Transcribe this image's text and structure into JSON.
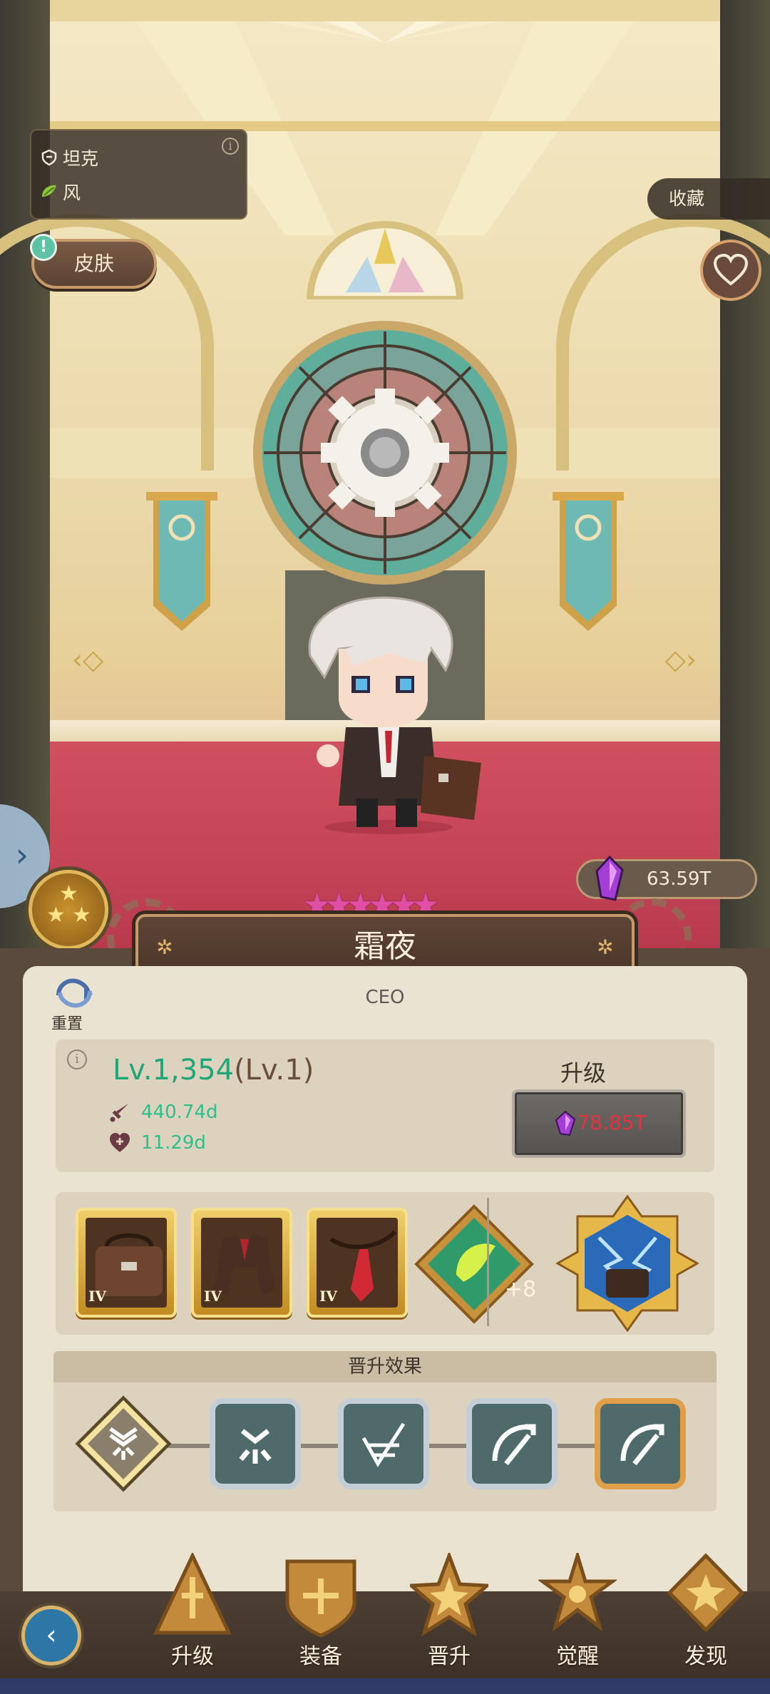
{
  "hero": {
    "role": "坦克",
    "element": "风",
    "name": "霜夜",
    "title": "CEO",
    "rarity_stars": 6,
    "tier_stars": 3
  },
  "buttons": {
    "skin": "皮肤",
    "collect": "收藏",
    "reset": "重置"
  },
  "currency": {
    "gems": "63.59T"
  },
  "stats": {
    "level": "Lv.1,354",
    "level_sub": "(Lv.1)",
    "attack": "440.74d",
    "hp": "11.29d",
    "upgrade_label": "升级",
    "upgrade_cost": "78.85T"
  },
  "equipment": {
    "items": [
      {
        "name": "briefcase",
        "tier": "IV"
      },
      {
        "name": "suit-jacket",
        "tier": "IV"
      },
      {
        "name": "necktie",
        "tier": "IV"
      }
    ],
    "rune_bonus": "+8"
  },
  "promotion": {
    "header": "晋升效果",
    "nodes": [
      "promo-node-1",
      "promo-node-2",
      "promo-node-3",
      "promo-node-4",
      "promo-node-5"
    ]
  },
  "nav": {
    "items": [
      "升级",
      "装备",
      "晋升",
      "觉醒",
      "发现"
    ]
  },
  "colors": {
    "level_green": "#1fa77a",
    "cost_red": "#e3333f",
    "star_pink": "#e04ea6",
    "panel": "#ebe3d2"
  }
}
